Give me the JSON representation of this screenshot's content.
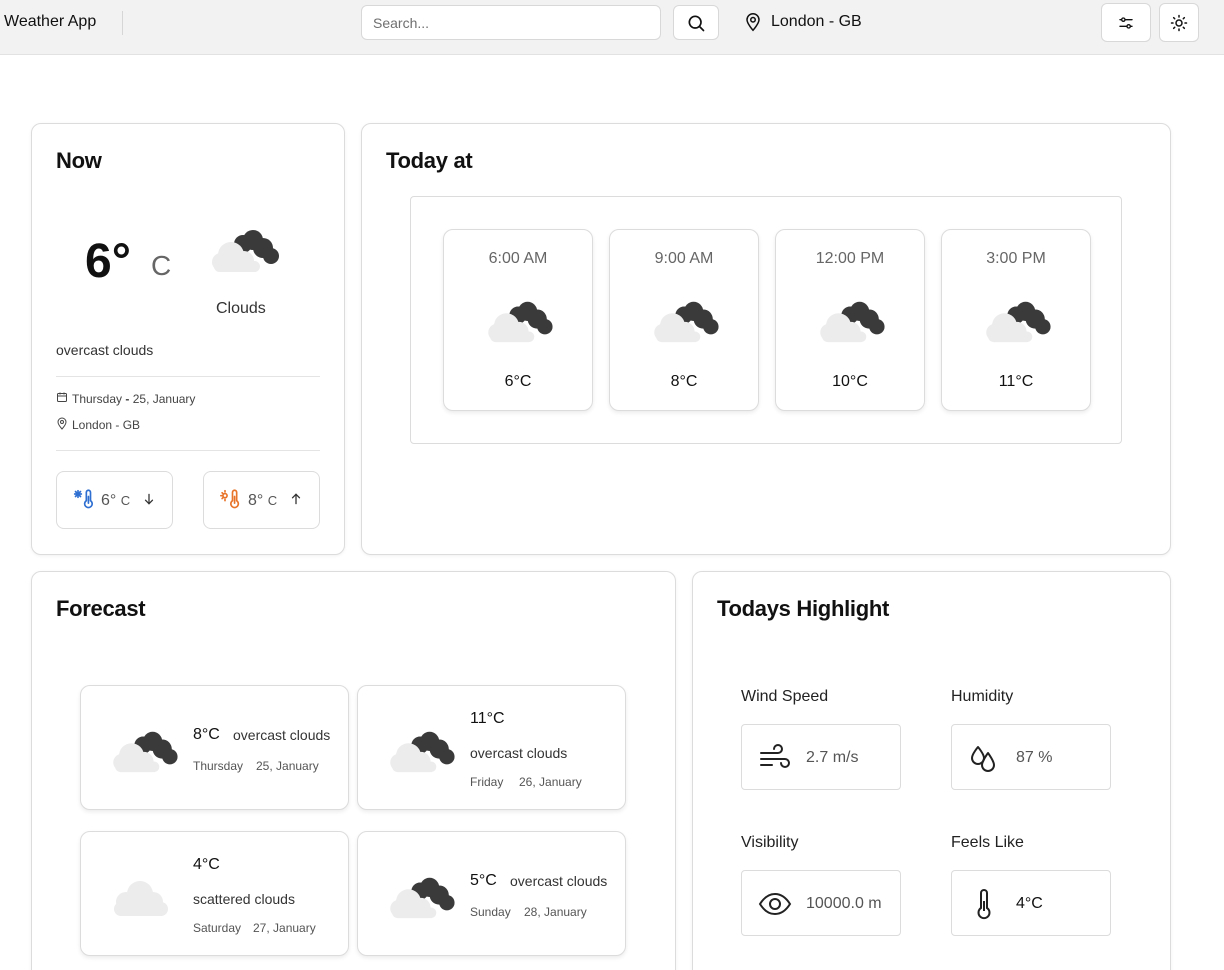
{
  "header": {
    "app_title": "Weather App",
    "search_placeholder": "Search...",
    "location": "London - GB"
  },
  "now": {
    "title": "Now",
    "temp": "6°",
    "unit": "C",
    "condition": "Clouds",
    "description": "overcast clouds",
    "weekday": "Thursday",
    "date": "25, January",
    "place": "London - GB",
    "min_temp": "6°",
    "min_unit": "C",
    "max_temp": "8°",
    "max_unit": "C",
    "icon": "cloud-sun-icon"
  },
  "today": {
    "title": "Today at",
    "hours": [
      {
        "time": "6:00 AM",
        "temp": "6°C"
      },
      {
        "time": "9:00 AM",
        "temp": "8°C"
      },
      {
        "time": "12:00 PM",
        "temp": "10°C"
      },
      {
        "time": "3:00 PM",
        "temp": "11°C"
      }
    ]
  },
  "forecast": {
    "title": "Forecast",
    "days": [
      {
        "temp": "8°C",
        "desc": "overcast clouds",
        "weekday": "Thursday",
        "date": "25, January",
        "icon": "overcast-cloud-icon"
      },
      {
        "temp": "11°C",
        "desc": "overcast clouds",
        "weekday": "Friday",
        "date": "26, January",
        "icon": "overcast-cloud-icon"
      },
      {
        "temp": "4°C",
        "desc": "scattered clouds",
        "weekday": "Saturday",
        "date": "27, January",
        "icon": "scattered-cloud-icon"
      },
      {
        "temp": "5°C",
        "desc": "overcast clouds",
        "weekday": "Sunday",
        "date": "28, January",
        "icon": "overcast-cloud-icon"
      }
    ]
  },
  "highlights": {
    "title": "Todays Highlight",
    "wind": {
      "label": "Wind Speed",
      "value": "2.7 m/s"
    },
    "humidity": {
      "label": "Humidity",
      "value": "87 %"
    },
    "visibility": {
      "label": "Visibility",
      "value": "10000.0 m"
    },
    "feels_like": {
      "label": "Feels Like",
      "value": "4°C"
    }
  },
  "colors": {
    "cold_icon": "#2f6fd1",
    "hot_icon": "#e8742a",
    "cloud_light": "#ececec",
    "cloud_dark": "#3a3a3a"
  }
}
